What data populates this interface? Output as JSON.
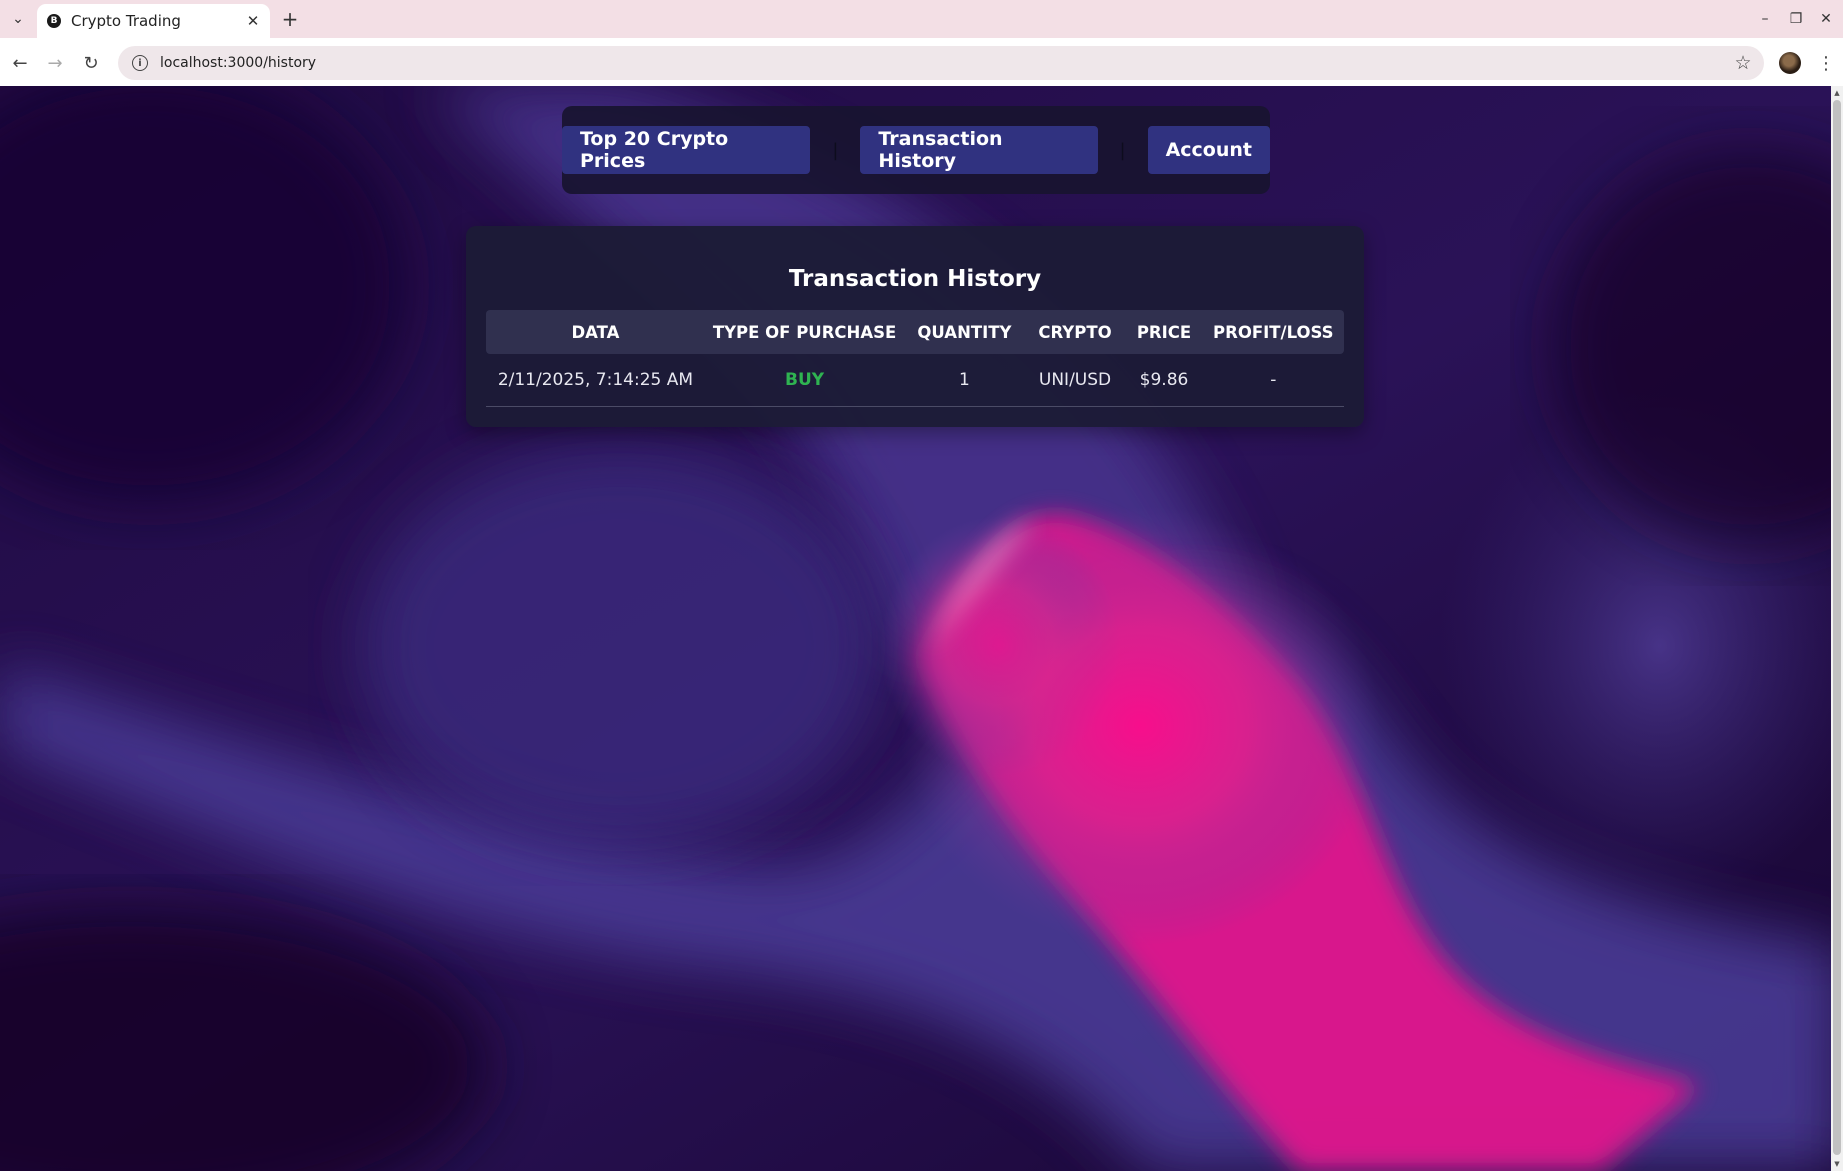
{
  "browser": {
    "tab_title": "Crypto Trading",
    "favicon_letter": "B",
    "url": "localhost:3000/history",
    "icons": {
      "tab_menu": "chevron-down-icon",
      "tab_close": "close-icon",
      "new_tab": "plus-icon",
      "back": "back-arrow-icon",
      "forward": "forward-arrow-icon",
      "reload": "reload-icon",
      "site_info": "info-icon",
      "bookmark": "star-icon",
      "menu": "kebab-menu-icon"
    }
  },
  "nav": {
    "items": [
      {
        "label": "Top 20 Crypto Prices"
      },
      {
        "label": "Transaction History"
      },
      {
        "label": "Account"
      }
    ],
    "separator": "|"
  },
  "history": {
    "title": "Transaction History",
    "columns": [
      "DATA",
      "TYPE OF PURCHASE",
      "QUANTITY",
      "CRYPTO",
      "PRICE",
      "PROFIT/LOSS"
    ],
    "rows": [
      {
        "date": "2/11/2025, 7:14:25 AM",
        "type": "BUY",
        "quantity": "1",
        "crypto": "UNI/USD",
        "price": "$9.86",
        "profit_loss": "-"
      }
    ]
  },
  "colors": {
    "background_dark": "#1b0836",
    "wave_purple": "#4f3b93",
    "wave_pink": "#f0138a",
    "nav_button": "#303280",
    "card": "#1c1b36",
    "buy_green": "#2fb351"
  }
}
